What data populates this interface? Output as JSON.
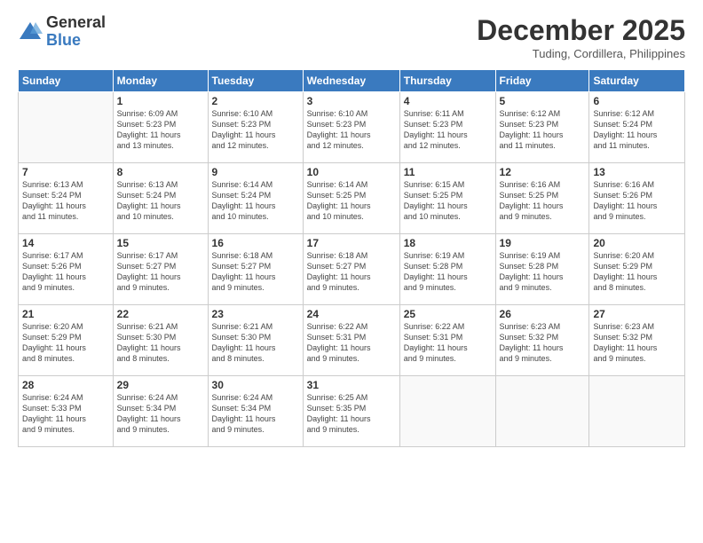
{
  "logo": {
    "general": "General",
    "blue": "Blue"
  },
  "header": {
    "month": "December 2025",
    "location": "Tuding, Cordillera, Philippines"
  },
  "days": [
    "Sunday",
    "Monday",
    "Tuesday",
    "Wednesday",
    "Thursday",
    "Friday",
    "Saturday"
  ],
  "weeks": [
    [
      {
        "day": "",
        "info": ""
      },
      {
        "day": "1",
        "info": "Sunrise: 6:09 AM\nSunset: 5:23 PM\nDaylight: 11 hours\nand 13 minutes."
      },
      {
        "day": "2",
        "info": "Sunrise: 6:10 AM\nSunset: 5:23 PM\nDaylight: 11 hours\nand 12 minutes."
      },
      {
        "day": "3",
        "info": "Sunrise: 6:10 AM\nSunset: 5:23 PM\nDaylight: 11 hours\nand 12 minutes."
      },
      {
        "day": "4",
        "info": "Sunrise: 6:11 AM\nSunset: 5:23 PM\nDaylight: 11 hours\nand 12 minutes."
      },
      {
        "day": "5",
        "info": "Sunrise: 6:12 AM\nSunset: 5:23 PM\nDaylight: 11 hours\nand 11 minutes."
      },
      {
        "day": "6",
        "info": "Sunrise: 6:12 AM\nSunset: 5:24 PM\nDaylight: 11 hours\nand 11 minutes."
      }
    ],
    [
      {
        "day": "7",
        "info": "Sunrise: 6:13 AM\nSunset: 5:24 PM\nDaylight: 11 hours\nand 11 minutes."
      },
      {
        "day": "8",
        "info": "Sunrise: 6:13 AM\nSunset: 5:24 PM\nDaylight: 11 hours\nand 10 minutes."
      },
      {
        "day": "9",
        "info": "Sunrise: 6:14 AM\nSunset: 5:24 PM\nDaylight: 11 hours\nand 10 minutes."
      },
      {
        "day": "10",
        "info": "Sunrise: 6:14 AM\nSunset: 5:25 PM\nDaylight: 11 hours\nand 10 minutes."
      },
      {
        "day": "11",
        "info": "Sunrise: 6:15 AM\nSunset: 5:25 PM\nDaylight: 11 hours\nand 10 minutes."
      },
      {
        "day": "12",
        "info": "Sunrise: 6:16 AM\nSunset: 5:25 PM\nDaylight: 11 hours\nand 9 minutes."
      },
      {
        "day": "13",
        "info": "Sunrise: 6:16 AM\nSunset: 5:26 PM\nDaylight: 11 hours\nand 9 minutes."
      }
    ],
    [
      {
        "day": "14",
        "info": "Sunrise: 6:17 AM\nSunset: 5:26 PM\nDaylight: 11 hours\nand 9 minutes."
      },
      {
        "day": "15",
        "info": "Sunrise: 6:17 AM\nSunset: 5:27 PM\nDaylight: 11 hours\nand 9 minutes."
      },
      {
        "day": "16",
        "info": "Sunrise: 6:18 AM\nSunset: 5:27 PM\nDaylight: 11 hours\nand 9 minutes."
      },
      {
        "day": "17",
        "info": "Sunrise: 6:18 AM\nSunset: 5:27 PM\nDaylight: 11 hours\nand 9 minutes."
      },
      {
        "day": "18",
        "info": "Sunrise: 6:19 AM\nSunset: 5:28 PM\nDaylight: 11 hours\nand 9 minutes."
      },
      {
        "day": "19",
        "info": "Sunrise: 6:19 AM\nSunset: 5:28 PM\nDaylight: 11 hours\nand 9 minutes."
      },
      {
        "day": "20",
        "info": "Sunrise: 6:20 AM\nSunset: 5:29 PM\nDaylight: 11 hours\nand 8 minutes."
      }
    ],
    [
      {
        "day": "21",
        "info": "Sunrise: 6:20 AM\nSunset: 5:29 PM\nDaylight: 11 hours\nand 8 minutes."
      },
      {
        "day": "22",
        "info": "Sunrise: 6:21 AM\nSunset: 5:30 PM\nDaylight: 11 hours\nand 8 minutes."
      },
      {
        "day": "23",
        "info": "Sunrise: 6:21 AM\nSunset: 5:30 PM\nDaylight: 11 hours\nand 8 minutes."
      },
      {
        "day": "24",
        "info": "Sunrise: 6:22 AM\nSunset: 5:31 PM\nDaylight: 11 hours\nand 9 minutes."
      },
      {
        "day": "25",
        "info": "Sunrise: 6:22 AM\nSunset: 5:31 PM\nDaylight: 11 hours\nand 9 minutes."
      },
      {
        "day": "26",
        "info": "Sunrise: 6:23 AM\nSunset: 5:32 PM\nDaylight: 11 hours\nand 9 minutes."
      },
      {
        "day": "27",
        "info": "Sunrise: 6:23 AM\nSunset: 5:32 PM\nDaylight: 11 hours\nand 9 minutes."
      }
    ],
    [
      {
        "day": "28",
        "info": "Sunrise: 6:24 AM\nSunset: 5:33 PM\nDaylight: 11 hours\nand 9 minutes."
      },
      {
        "day": "29",
        "info": "Sunrise: 6:24 AM\nSunset: 5:34 PM\nDaylight: 11 hours\nand 9 minutes."
      },
      {
        "day": "30",
        "info": "Sunrise: 6:24 AM\nSunset: 5:34 PM\nDaylight: 11 hours\nand 9 minutes."
      },
      {
        "day": "31",
        "info": "Sunrise: 6:25 AM\nSunset: 5:35 PM\nDaylight: 11 hours\nand 9 minutes."
      },
      {
        "day": "",
        "info": ""
      },
      {
        "day": "",
        "info": ""
      },
      {
        "day": "",
        "info": ""
      }
    ]
  ]
}
